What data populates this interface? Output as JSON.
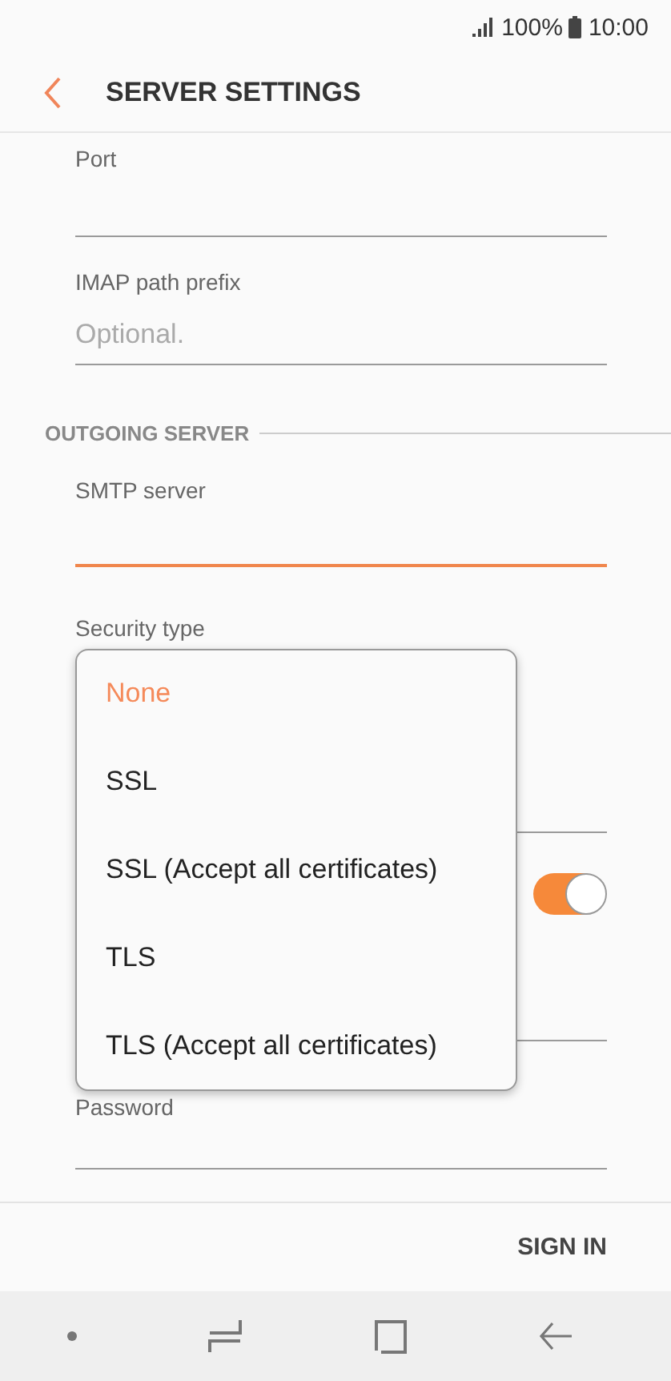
{
  "status_bar": {
    "battery": "100%",
    "time": "10:00"
  },
  "header": {
    "title": "SERVER SETTINGS"
  },
  "form": [
    {
      "kind": "field",
      "label": "Port",
      "focused": false
    },
    {
      "kind": "field",
      "label": "IMAP path prefix",
      "placeholder": "Optional.",
      "focused": false
    },
    {
      "kind": "section",
      "title": "OUTGOING SERVER"
    },
    {
      "kind": "field",
      "label": "SMTP server",
      "focused": true
    },
    {
      "kind": "select",
      "label": "Security type",
      "expanded": true,
      "options": [
        {
          "label": "None",
          "selected": true
        },
        {
          "label": "SSL",
          "selected": false
        },
        {
          "label": "SSL (Accept all certificates)",
          "selected": false
        },
        {
          "label": "TLS",
          "selected": false
        },
        {
          "label": "TLS (Accept all certificates)",
          "selected": false
        }
      ]
    },
    {
      "kind": "toggle",
      "on": true
    },
    {
      "kind": "field",
      "focused": false
    },
    {
      "kind": "field",
      "label": "Password",
      "focused": false
    }
  ],
  "footer": {
    "button": "SIGN IN"
  }
}
